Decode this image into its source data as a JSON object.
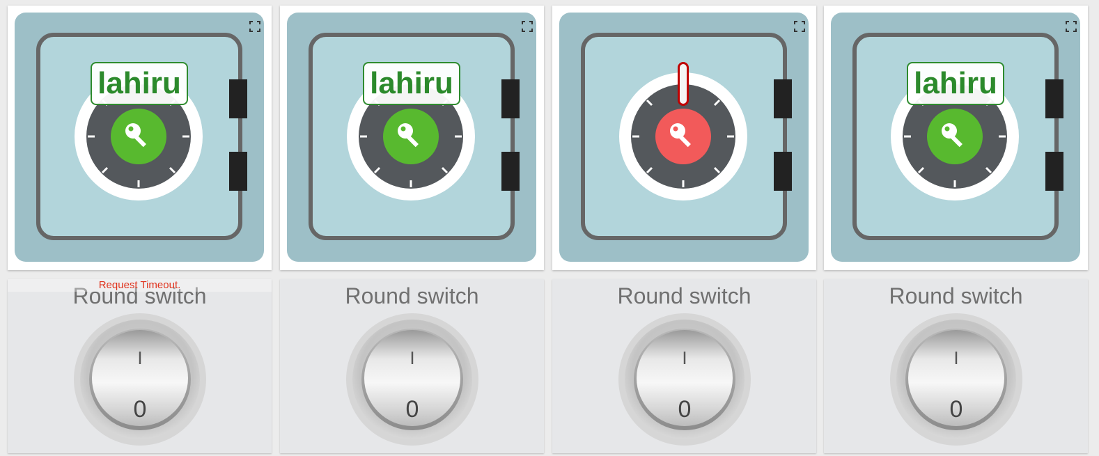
{
  "colors": {
    "safe_body": "#9dbfc7",
    "safe_door": "#b2d5db",
    "ok_green": "#58b92f",
    "alert_red": "#f25a5a",
    "label_green": "#2c8a2c",
    "error_red": "#e0321c"
  },
  "widgets": [
    {
      "safe": {
        "status": "ok",
        "label": "lahiru",
        "icon": "key-icon",
        "fullscreen_icon": "fullscreen-icon"
      },
      "switch": {
        "title": "Round switch",
        "on_mark": "I",
        "off_mark": "0",
        "error": "Request Timeout."
      }
    },
    {
      "safe": {
        "status": "ok",
        "label": "lahiru",
        "icon": "key-icon",
        "fullscreen_icon": "fullscreen-icon"
      },
      "switch": {
        "title": "Round switch",
        "on_mark": "I",
        "off_mark": "0"
      }
    },
    {
      "safe": {
        "status": "alert",
        "icon": "key-icon",
        "fullscreen_icon": "fullscreen-icon"
      },
      "switch": {
        "title": "Round switch",
        "on_mark": "I",
        "off_mark": "0"
      }
    },
    {
      "safe": {
        "status": "ok",
        "label": "lahiru",
        "icon": "key-icon",
        "fullscreen_icon": "fullscreen-icon"
      },
      "switch": {
        "title": "Round switch",
        "on_mark": "I",
        "off_mark": "0"
      }
    }
  ]
}
